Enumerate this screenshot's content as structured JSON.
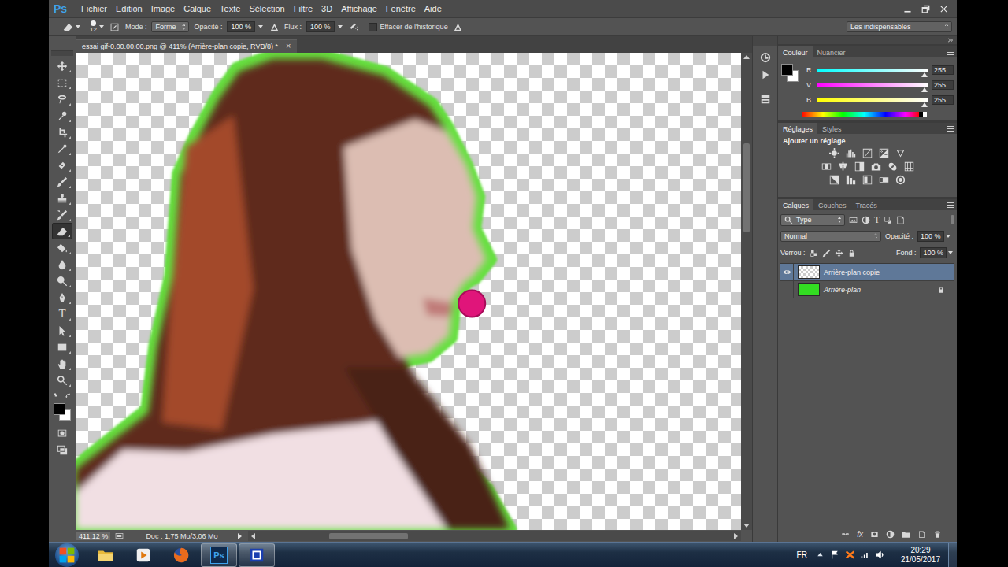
{
  "menubar": {
    "logo": "Ps",
    "menus": [
      "Fichier",
      "Edition",
      "Image",
      "Calque",
      "Texte",
      "Sélection",
      "Filtre",
      "3D",
      "Affichage",
      "Fenêtre",
      "Aide"
    ]
  },
  "options": {
    "brush_size": "12",
    "mode_label": "Mode :",
    "mode": "Forme",
    "opacity_label": "Opacité :",
    "opacity": "100 %",
    "flow_label": "Flux :",
    "flow": "100 %",
    "history_label": "Effacer de l'historique",
    "history_checked": false,
    "workspace": "Les indispensables"
  },
  "document": {
    "tab_title": "essai gif-0.00.00.00.png @ 411% (Arrière-plan copie, RVB/8) *",
    "close": "×",
    "zoom": "411,12 %",
    "info": "Doc : 1,75 Mo/3,06 Mo",
    "scroll": {
      "vertical": 0.22,
      "horizontal": 0.18
    }
  },
  "tools": [
    {
      "kind": "move",
      "glyph": "",
      "selected": false
    },
    {
      "kind": "marquee",
      "glyph": "",
      "selected": false
    },
    {
      "kind": "lasso",
      "glyph": "",
      "selected": false
    },
    {
      "kind": "quick-select",
      "glyph": "",
      "selected": false
    },
    {
      "kind": "crop",
      "glyph": "",
      "selected": false
    },
    {
      "kind": "eyedropper",
      "glyph": "",
      "selected": false
    },
    {
      "kind": "healing",
      "glyph": "",
      "selected": false
    },
    {
      "kind": "brush",
      "glyph": "",
      "selected": false
    },
    {
      "kind": "stamp",
      "glyph": "",
      "selected": false
    },
    {
      "kind": "history-brush",
      "glyph": "",
      "selected": false
    },
    {
      "kind": "eraser",
      "glyph": "",
      "selected": true
    },
    {
      "kind": "bucket",
      "glyph": "",
      "selected": false
    },
    {
      "kind": "blur",
      "glyph": "",
      "selected": false
    },
    {
      "kind": "dodge",
      "glyph": "",
      "selected": false
    },
    {
      "kind": "pen",
      "glyph": "",
      "selected": false
    },
    {
      "kind": "type",
      "glyph": "T",
      "selected": false
    },
    {
      "kind": "path-select",
      "glyph": "",
      "selected": false
    },
    {
      "kind": "rectangle",
      "glyph": "",
      "selected": false
    },
    {
      "kind": "hand",
      "glyph": "",
      "selected": false
    },
    {
      "kind": "zoom",
      "glyph": "",
      "selected": false
    }
  ],
  "colors": {
    "foreground": "#000000",
    "background": "#ffffff"
  },
  "color_panel": {
    "tabs": [
      {
        "label": "Couleur",
        "selected": true
      },
      {
        "label": "Nuancier",
        "selected": false
      }
    ],
    "channels": [
      {
        "name": "R",
        "value": "255",
        "level": 1,
        "color": "#00ffff"
      },
      {
        "name": "V",
        "value": "255",
        "level": 1,
        "color": "#ff00ff"
      },
      {
        "name": "B",
        "value": "255",
        "level": 1,
        "color": "#ffff00"
      }
    ]
  },
  "adjustments_panel": {
    "tabs": [
      {
        "label": "Réglages",
        "selected": true
      },
      {
        "label": "Styles",
        "selected": false
      }
    ],
    "title": "Ajouter un réglage"
  },
  "layers_panel": {
    "tabs": [
      {
        "label": "Calques",
        "selected": true
      },
      {
        "label": "Couches",
        "selected": false
      },
      {
        "label": "Tracés",
        "selected": false
      }
    ],
    "filter": "Type",
    "filter_glyph": "T",
    "blend_mode": "Normal",
    "opacity_label": "Opacité :",
    "opacity": "100 %",
    "lock_label": "Verrou :",
    "fill_label": "Fond :",
    "fill": "100 %",
    "fx_label": "fx",
    "layers": [
      {
        "name": "Arrière-plan copie",
        "selected": true,
        "visible": true,
        "locked": false,
        "kind": "transparent",
        "color": "#ffffff"
      },
      {
        "name": "Arrière-plan",
        "selected": false,
        "visible": false,
        "locked": true,
        "kind": "solid",
        "color": "#33dd22"
      }
    ]
  },
  "taskbar": {
    "items": [
      {
        "kind": "explorer",
        "glyph": "",
        "open": false
      },
      {
        "kind": "media",
        "glyph": "",
        "open": false
      },
      {
        "kind": "firefox",
        "glyph": "",
        "open": false
      },
      {
        "kind": "photoshop",
        "glyph": "Ps",
        "open": true
      },
      {
        "kind": "app",
        "glyph": "",
        "open": true
      }
    ],
    "language": "FR",
    "time": "20:29",
    "date": "21/05/2017"
  }
}
